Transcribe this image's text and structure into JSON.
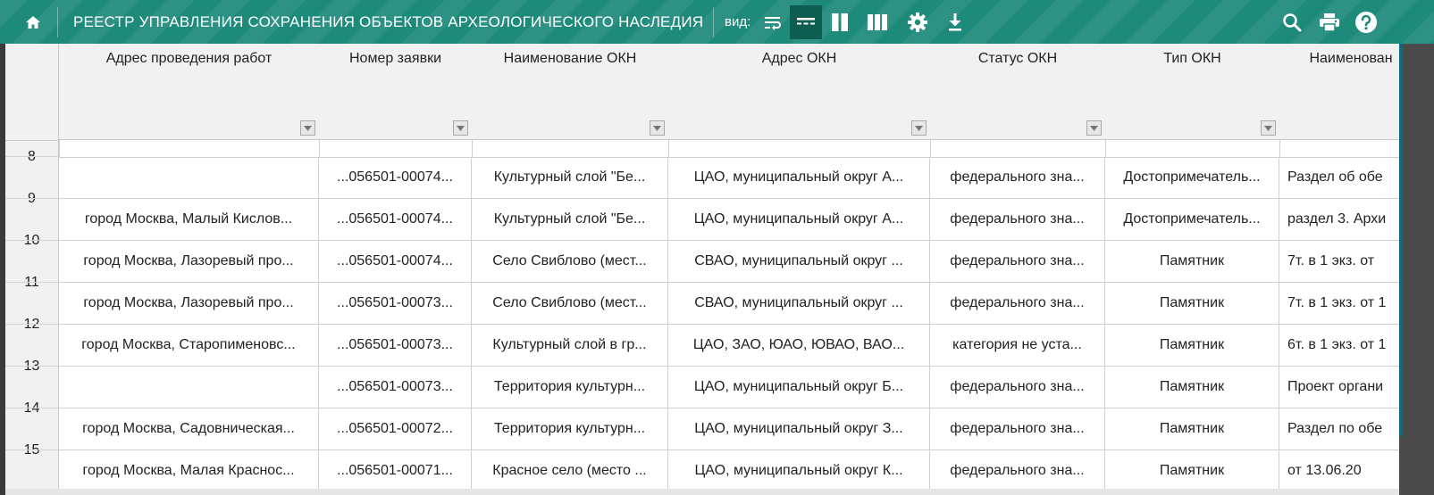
{
  "topbar": {
    "title": "РЕЕСТР УПРАВЛЕНИЯ СОХРАНЕНИЯ ОБЪЕКТОВ АРХЕОЛОГИЧЕСКОГО НАСЛЕДИЯ",
    "view_label": "вид:",
    "icons": [
      "home-icon",
      "wrap-text-icon",
      "table-rows-icon",
      "two-columns-icon",
      "three-columns-icon",
      "gear-icon",
      "download-icon",
      "search-icon",
      "print-icon",
      "help-icon"
    ],
    "accent": "#1d8a7a",
    "active_button_color": "#0e5d51"
  },
  "table": {
    "columns": [
      "Адрес проведения работ",
      "Номер заявки",
      "Наименование ОКН",
      "Адрес ОКН",
      "Статус ОКН",
      "Тип ОКН",
      "Наименован"
    ],
    "rows": [
      {
        "num": "8",
        "cells": [
          "",
          "...056501-00074...",
          "Культурный слой \"Бе...",
          "ЦАО, муниципальный округ А...",
          "федерального зна...",
          "Достопримечатель...",
          "Раздел об обе"
        ]
      },
      {
        "num": "9",
        "cells": [
          "город Москва, Малый Кислов...",
          "...056501-00074...",
          "Культурный слой \"Бе...",
          "ЦАО, муниципальный округ А...",
          "федерального зна...",
          "Достопримечатель...",
          "раздел 3. Архи"
        ]
      },
      {
        "num": "10",
        "cells": [
          "город Москва, Лазоревый про...",
          "...056501-00074...",
          "Село Свиблово (мест...",
          "СВАО, муниципальный округ ...",
          "федерального зна...",
          "Памятник",
          "7т. в 1 экз. от"
        ]
      },
      {
        "num": "11",
        "cells": [
          "город Москва, Лазоревый про...",
          "...056501-00073...",
          "Село Свиблово (мест...",
          "СВАО, муниципальный округ ...",
          "федерального зна...",
          "Памятник",
          "7т. в 1 экз. от 1"
        ]
      },
      {
        "num": "12",
        "cells": [
          "город Москва, Старопименовс...",
          "...056501-00073...",
          "Культурный слой в гр...",
          "ЦАО, ЗАО, ЮАО, ЮВАО, ВАО...",
          "категория не уста...",
          "Памятник",
          "6т. в 1 экз. от 1"
        ]
      },
      {
        "num": "13",
        "cells": [
          "",
          "...056501-00073...",
          "Территория культурн...",
          "ЦАО, муниципальный округ Б...",
          "федерального зна...",
          "Памятник",
          "Проект органи"
        ]
      },
      {
        "num": "14",
        "cells": [
          "город Москва, Садовническая...",
          "...056501-00072...",
          "Территория культурн...",
          "ЦАО, муниципальный округ З...",
          "федерального зна...",
          "Памятник",
          "Раздел по обе"
        ]
      },
      {
        "num": "15",
        "cells": [
          "город Москва, Малая Краснос...",
          "...056501-00071...",
          "Красное село (место ...",
          "ЦАО, муниципальный округ К...",
          "федерального зна...",
          "Памятник",
          "от 13.06.20"
        ]
      }
    ]
  }
}
